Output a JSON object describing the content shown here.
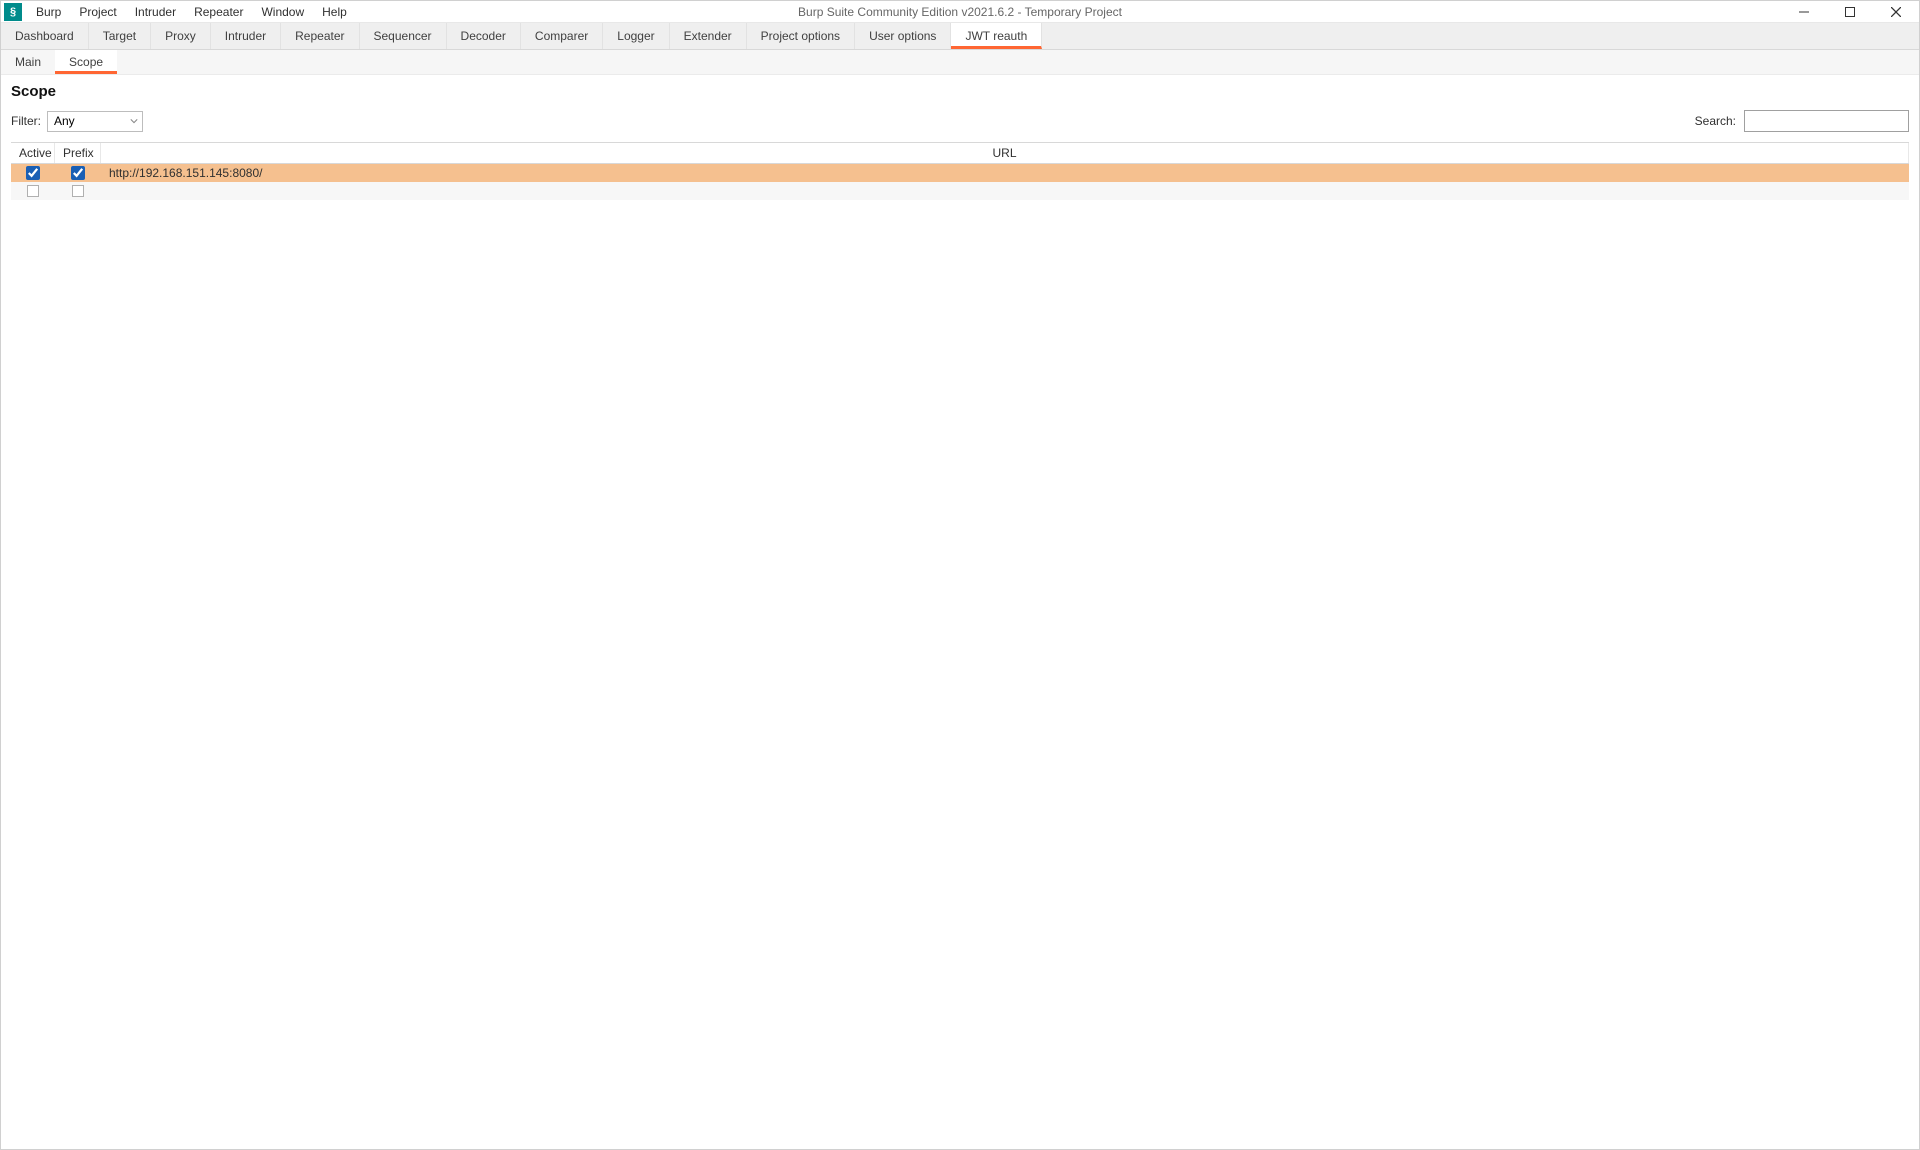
{
  "window": {
    "title": "Burp Suite Community Edition v2021.6.2 - Temporary Project",
    "app_icon_text": "§"
  },
  "menubar": [
    "Burp",
    "Project",
    "Intruder",
    "Repeater",
    "Window",
    "Help"
  ],
  "main_tabs": [
    "Dashboard",
    "Target",
    "Proxy",
    "Intruder",
    "Repeater",
    "Sequencer",
    "Decoder",
    "Comparer",
    "Logger",
    "Extender",
    "Project options",
    "User options",
    "JWT reauth"
  ],
  "main_tab_active_index": 12,
  "sub_tabs": [
    "Main",
    "Scope"
  ],
  "sub_tab_active_index": 1,
  "page_title": "Scope",
  "filter": {
    "label": "Filter:",
    "value": "Any"
  },
  "search": {
    "label": "Search:",
    "value": ""
  },
  "table": {
    "headers": {
      "active": "Active",
      "prefix": "Prefix",
      "url": "URL"
    },
    "rows": [
      {
        "active": true,
        "prefix": true,
        "url": "http://192.168.151.145:8080/",
        "selected": true
      },
      {
        "active": false,
        "prefix": false,
        "url": "",
        "selected": false
      }
    ]
  }
}
